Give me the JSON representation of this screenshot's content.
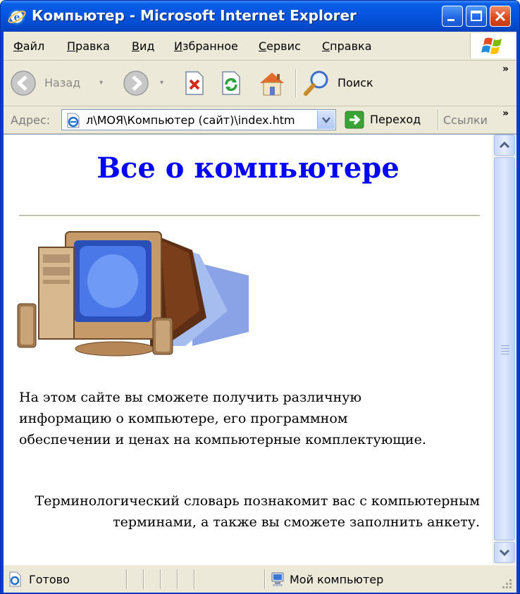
{
  "window": {
    "title": "Компьютер - Microsoft Internet Explorer",
    "accent_color": "#0a5ee8",
    "buttons": [
      "minimize-icon",
      "maximize-icon",
      "close-icon"
    ]
  },
  "menubar": {
    "items": [
      {
        "hotkey": "Ф",
        "rest": "айл"
      },
      {
        "hotkey": "П",
        "rest": "равка"
      },
      {
        "hotkey": "В",
        "rest": "ид"
      },
      {
        "hotkey": "И",
        "rest": "збранное"
      },
      {
        "hotkey": "С",
        "rest": "ервис"
      },
      {
        "hotkey": "С",
        "rest": "правка"
      }
    ]
  },
  "toolbar": {
    "back_label": "Назад",
    "search_label": "Поиск",
    "more": "»"
  },
  "addressbar": {
    "label": "Адрес:",
    "value": "л\\МОЯ\\Компьютер (сайт)\\index.htm",
    "go_label": "Переход",
    "links_label": "Ссылки",
    "more": "»"
  },
  "page": {
    "heading": "Все о компьютере",
    "heading_color": "#0000ff",
    "paragraph1": "На этом сайте вы сможете получить различную информацию о компьютере, его программном обеспечении и ценах на компьютерные комплектующие.",
    "paragraph2": "Терминологический словарь познакомит вас с компьютерным терминами, а также вы сможете заполнить анкету."
  },
  "statusbar": {
    "status": "Готово",
    "zone": "Мой компьютер"
  }
}
